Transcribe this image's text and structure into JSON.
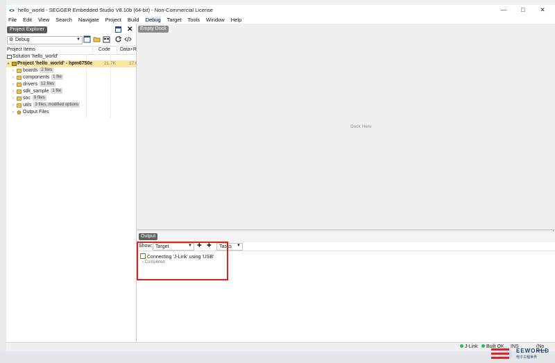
{
  "window": {
    "title": "hello_world - SEGGER Embedded Studio V8.10b (64-bit) - Non-Commercial License",
    "controls": [
      "—",
      "□",
      "✕"
    ]
  },
  "menu": [
    "File",
    "Edit",
    "View",
    "Search",
    "Navigate",
    "Project",
    "Build",
    "Debug",
    "Target",
    "Tools",
    "Window",
    "Help"
  ],
  "project_explorer": {
    "tab_label": "Project Explorer",
    "close": "✕",
    "configuration": "Debug",
    "columns": {
      "items": "Project Items",
      "code": "Code",
      "data": "Data+RO"
    },
    "solution": "Solution 'hello_world'",
    "project": {
      "label": "Project 'hello_world' - hpm6750e",
      "code": "21.7K",
      "data": "17.6K"
    },
    "folders": [
      {
        "name": "boards",
        "badge": "2 files"
      },
      {
        "name": "components",
        "badge": "1 file"
      },
      {
        "name": "drivers",
        "badge": "12 files"
      },
      {
        "name": "sdk_sample",
        "badge": "1 file"
      },
      {
        "name": "soc",
        "badge": "9 files"
      },
      {
        "name": "utils",
        "badge": "3 files, modified options"
      },
      {
        "name": "Output Files",
        "badge": ""
      }
    ]
  },
  "dock": {
    "tab_label": "Empty Dock",
    "placeholder": "Dock Here"
  },
  "output": {
    "tab_label": "Output",
    "show_label": "Show:",
    "show_value": "Target",
    "tasks_value": "Tasks",
    "messages": [
      {
        "text": "Connecting 'J-Link' using 'USB'"
      },
      {
        "text": "Completed"
      }
    ]
  },
  "status_bar": {
    "jlink": "J-Link",
    "build_ok": "Built OK",
    "ins": "INS",
    "editor": "(No edito"
  },
  "watermark": {
    "brand": "EEWORLD",
    "sub": "电子工程世界"
  },
  "colors": {
    "highlight_row": "#fde7a6",
    "annotation": "#e0211a",
    "ok_dot": "#2fb34a"
  }
}
